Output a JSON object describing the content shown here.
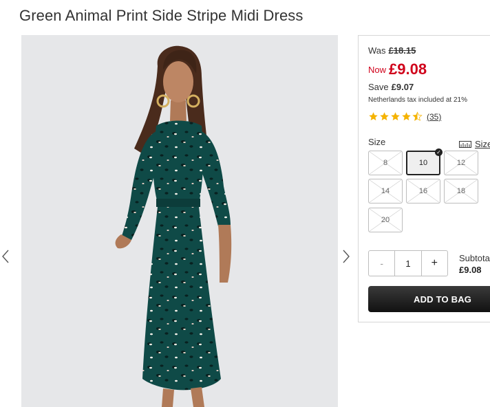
{
  "product": {
    "title": "Green Animal Print Side Stripe Midi Dress"
  },
  "pricing": {
    "was_label": "Was",
    "was_price": "£18.15",
    "now_label": "Now",
    "now_price": "£9.08",
    "save_label": "Save",
    "save_amount": "£9.07",
    "tax_note": "Netherlands tax included at 21%",
    "accent_color": "#d0021b"
  },
  "rating": {
    "stars": 4.5,
    "review_count": "(35)",
    "star_color": "#f5b301"
  },
  "sizes": {
    "label": "Size",
    "guide_label": "Size",
    "guide_icon": "ruler-icon",
    "options": [
      {
        "label": "8",
        "available": false
      },
      {
        "label": "10",
        "available": true,
        "selected": true
      },
      {
        "label": "12",
        "available": false
      },
      {
        "label": "14",
        "available": false
      },
      {
        "label": "16",
        "available": false
      },
      {
        "label": "18",
        "available": false
      },
      {
        "label": "20",
        "available": false
      }
    ]
  },
  "quantity": {
    "minus": "-",
    "value": "1",
    "plus": "+"
  },
  "subtotal": {
    "label": "Subtotal",
    "value": "£9.08"
  },
  "cta": {
    "add_to_bag": "ADD TO BAG"
  },
  "gallery": {
    "prev_icon": "chevron-left-icon",
    "next_icon": "chevron-right-icon",
    "dress_color": "#0f4a47"
  }
}
